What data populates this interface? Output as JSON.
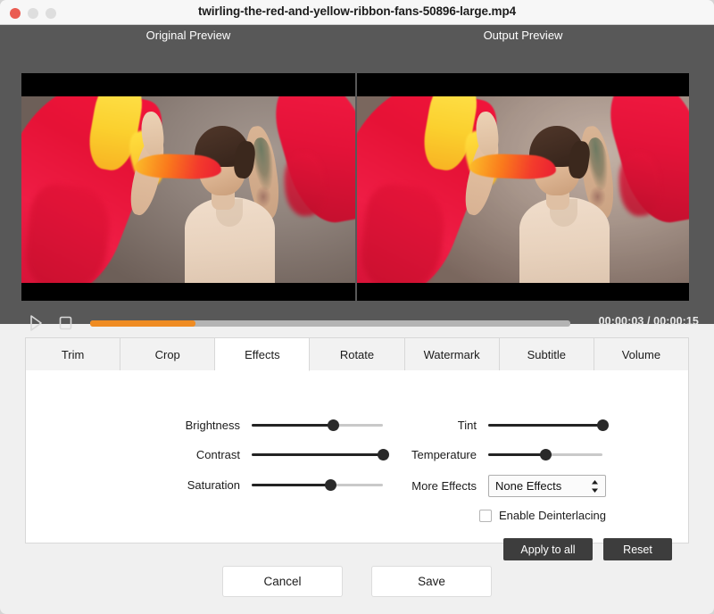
{
  "window": {
    "title": "twirling-the-red-and-yellow-ribbon-fans-50896-large.mp4",
    "traffic_lights": {
      "close_color": "#ea5c52",
      "minimize_color": "#dedede",
      "maximize_color": "#dedede"
    }
  },
  "preview": {
    "original_label": "Original Preview",
    "output_label": "Output  Preview",
    "scene_description": "Dancer in beige leotard twirling red and yellow ribbon fans against a warm grey backdrop"
  },
  "transport": {
    "play_icon": "play-triangle-outline",
    "stop_icon": "stop-square-outline",
    "current_time": "00:00:03",
    "total_time": "00:00:15",
    "timecode": "00:00:03 / 00:00:15",
    "progress_percent": 22,
    "fill_color": "#ef8c23",
    "track_color": "#b4b4b4"
  },
  "tabs": [
    {
      "label": "Trim",
      "active": false
    },
    {
      "label": "Crop",
      "active": false
    },
    {
      "label": "Effects",
      "active": true
    },
    {
      "label": "Rotate",
      "active": false
    },
    {
      "label": "Watermark",
      "active": false
    },
    {
      "label": "Subtitle",
      "active": false
    },
    {
      "label": "Volume",
      "active": false
    }
  ],
  "effects": {
    "sliders_left": [
      {
        "label": "Brightness",
        "value": 62
      },
      {
        "label": "Contrast",
        "value": 100
      },
      {
        "label": "Saturation",
        "value": 60
      }
    ],
    "sliders_right": [
      {
        "label": "Tint",
        "value": 100
      },
      {
        "label": "Temperature",
        "value": 50
      }
    ],
    "more_effects": {
      "label": "More Effects",
      "value": "None Effects",
      "stepper_icon": "stepper-up-down-icon"
    },
    "deinterlacing": {
      "label": "Enable Deinterlacing",
      "checked": false
    },
    "apply_to_all_label": "Apply to all",
    "reset_label": "Reset"
  },
  "footer": {
    "cancel_label": "Cancel",
    "save_label": "Save"
  }
}
